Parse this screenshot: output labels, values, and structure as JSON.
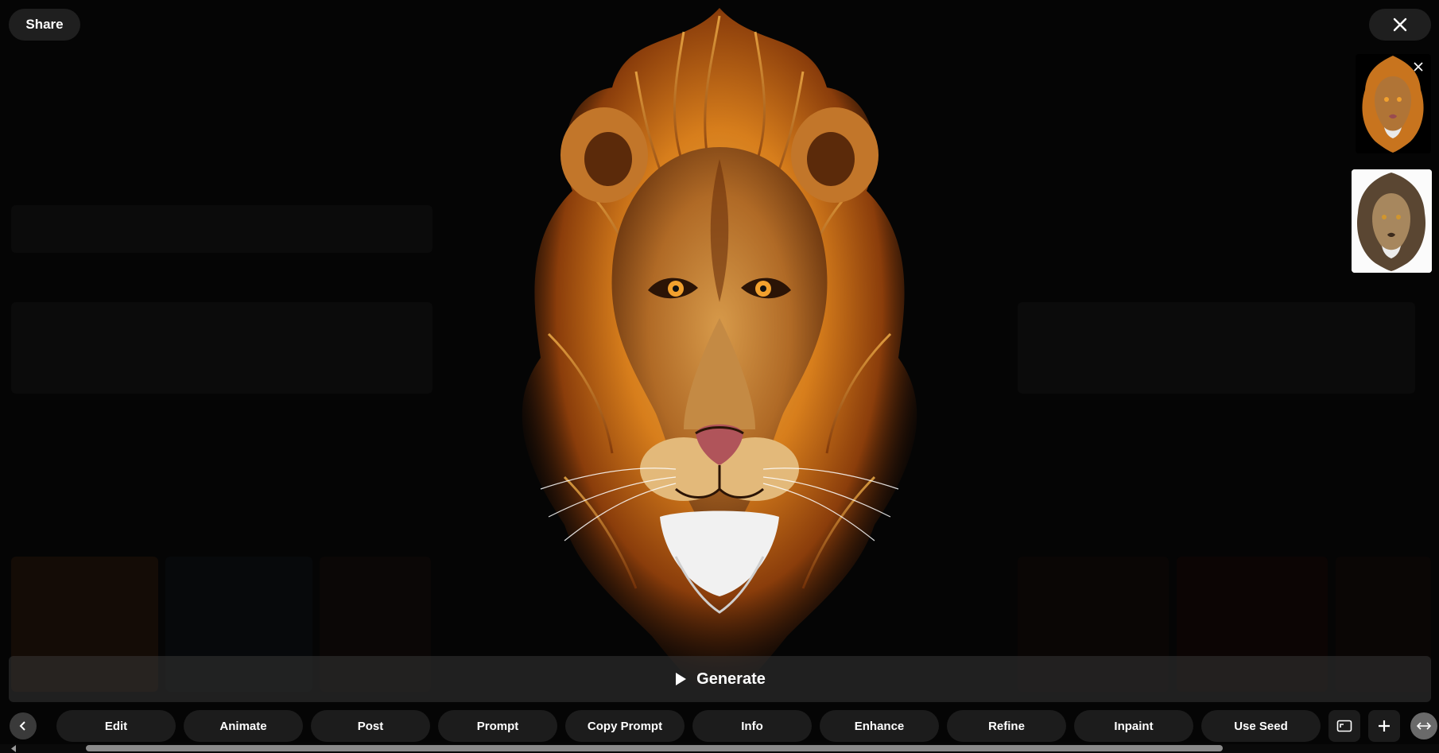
{
  "header": {
    "share_label": "Share",
    "close_icon": "close-icon"
  },
  "main_image": {
    "subject": "lion-head-illustration"
  },
  "thumbnails": [
    {
      "name": "lion-thumbnail-color",
      "selected": true
    },
    {
      "name": "lion-thumbnail-sketch",
      "selected": false
    }
  ],
  "generate": {
    "label": "Generate",
    "icon": "play-icon"
  },
  "toolbar": {
    "prev_icon": "chevron-left-icon",
    "buttons": [
      "Edit",
      "Animate",
      "Post",
      "Prompt",
      "Copy Prompt",
      "Info",
      "Enhance",
      "Refine",
      "Inpaint",
      "Use Seed"
    ],
    "aspect_icon": "aspect-ratio-icon",
    "add_icon": "plus-icon",
    "compare_icon": "compare-icon"
  },
  "colors": {
    "background": "#000000",
    "button_bg": "#1c1c1c",
    "mane_dark": "#6b2e07",
    "mane_light": "#e89a2c"
  }
}
